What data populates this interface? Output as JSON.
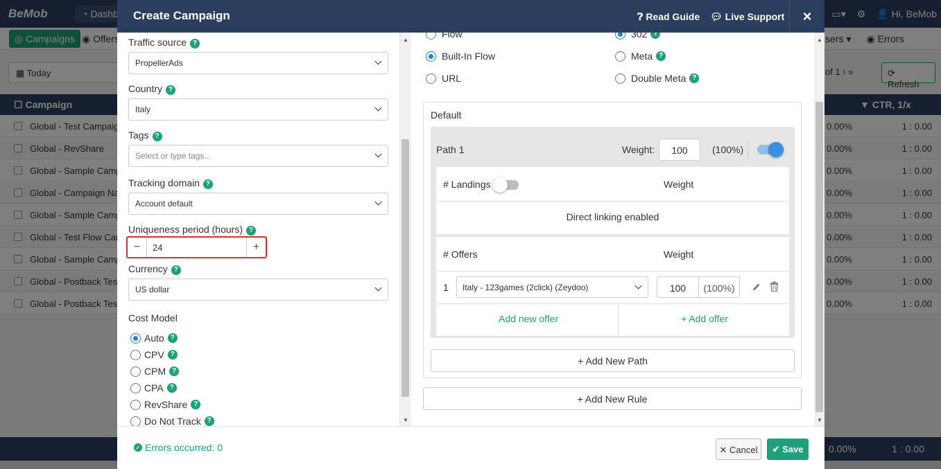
{
  "app": {
    "logo": "BeMob",
    "dashboard_tab": "Dashbo",
    "greeting": "Hi, BeMob",
    "nav_campaigns": "Campaigns",
    "nav_offers": "Offers",
    "nav_sers": "sers",
    "nav_errors": "Errors",
    "date_filter": "Today",
    "pager": "of 1",
    "refresh": "Refresh",
    "col_campaign": "Campaign",
    "col_ctr": "CTR, 1/x",
    "rows": [
      {
        "name": "Global - Test Campaign",
        "pct": "0.00%",
        "ctr": "1 : 0.00"
      },
      {
        "name": "Global - RevShare",
        "pct": "0.00%",
        "ctr": "1 : 0.00"
      },
      {
        "name": "Global - Sample Campaign",
        "pct": "0.00%",
        "ctr": "1 : 0.00"
      },
      {
        "name": "Global - Campaign Name",
        "pct": "0.00%",
        "ctr": "1 : 0.00"
      },
      {
        "name": "Global - Sample Campaign",
        "pct": "0.00%",
        "ctr": "1 : 0.00"
      },
      {
        "name": "Global - Test Flow Campaign",
        "pct": "0.00%",
        "ctr": "1 : 0.00"
      },
      {
        "name": "Global - Sample Campaign",
        "pct": "0.00%",
        "ctr": "1 : 0.00"
      },
      {
        "name": "Global - Postback Test",
        "pct": "0.00%",
        "ctr": "1 : 0.00"
      },
      {
        "name": "Global - Postback Test",
        "pct": "0.00%",
        "ctr": "1 : 0.00"
      }
    ],
    "total_pct": "0.00%",
    "total_ctr": "1 : 0.00"
  },
  "modal": {
    "title": "Create Campaign",
    "read_guide": "Read Guide",
    "live_support": "Live Support",
    "close": "×",
    "form": {
      "traffic_source_label": "Traffic source",
      "traffic_source_value": "PropellerAds",
      "country_label": "Country",
      "country_value": "Italy",
      "tags_label": "Tags",
      "tags_placeholder": "Select or type tags...",
      "tracking_domain_label": "Tracking domain",
      "tracking_domain_value": "Account default",
      "uniqueness_label": "Uniqueness period (hours)",
      "uniqueness_value": "24",
      "currency_label": "Currency",
      "currency_value": "US dollar",
      "cost_model_label": "Cost Model",
      "cost_models": [
        "Auto",
        "CPV",
        "CPM",
        "CPA",
        "RevShare",
        "Do Not Track"
      ],
      "cost_model_selected": "Auto"
    },
    "destination": {
      "options": [
        "Flow",
        "Built-In Flow",
        "URL"
      ],
      "selected": "Built-In Flow",
      "redirect_options": [
        "302",
        "Meta",
        "Double Meta"
      ],
      "redirect_selected": "302"
    },
    "default_label": "Default",
    "path": {
      "name": "Path 1",
      "weight_label": "Weight:",
      "weight": "100",
      "weight_pct": "(100%)",
      "enabled": true,
      "landings_header": "# Landings",
      "weight_header": "Weight",
      "direct_linking": "Direct linking enabled",
      "offers_header": "# Offers",
      "offers": [
        {
          "index": "1",
          "name": "Italy - 123games (2click) (Zeydoo)",
          "weight": "100",
          "pct": "(100%)"
        }
      ],
      "add_new_offer": "Add new offer",
      "add_offer": "+ Add offer"
    },
    "add_new_path": "+ Add New Path",
    "add_new_rule": "+ Add New Rule",
    "errors_text": "Errors occurred: 0",
    "cancel": "Cancel",
    "save": "Save"
  },
  "colors": {
    "header": "#2c3e5e",
    "accent": "#1fa07a",
    "highlight": "#d9302a",
    "toggle": "#3b8fe0"
  }
}
